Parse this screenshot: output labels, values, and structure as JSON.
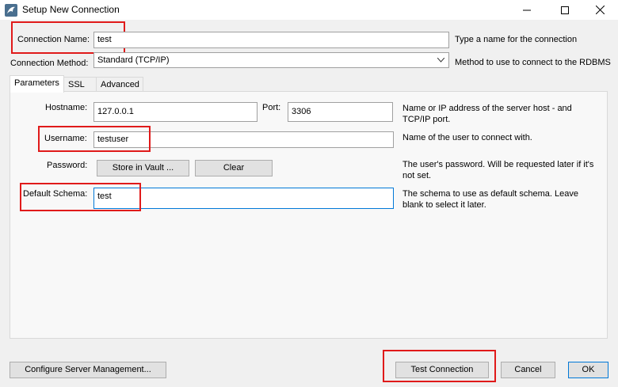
{
  "window": {
    "title": "Setup New Connection",
    "icons": {
      "app": "mysql-dolphin-icon",
      "minimize": "minimize-icon",
      "maximize": "maximize-icon",
      "close": "close-icon"
    }
  },
  "connection": {
    "name_label": "Connection Name:",
    "name_value": "test",
    "name_hint": "Type a name for the connection",
    "method_label": "Connection Method:",
    "method_value": "Standard (TCP/IP)",
    "method_hint": "Method to use to connect to the RDBMS"
  },
  "tabs": [
    {
      "label": "Parameters",
      "active": true
    },
    {
      "label": "SSL",
      "active": false
    },
    {
      "label": "Advanced",
      "active": false
    }
  ],
  "parameters": {
    "hostname_label": "Hostname:",
    "hostname_value": "127.0.0.1",
    "port_label": "Port:",
    "port_value": "3306",
    "hostname_hint": "Name or IP address of the server host - and TCP/IP port.",
    "username_label": "Username:",
    "username_value": "testuser",
    "username_hint": "Name of the user to connect with.",
    "password_label": "Password:",
    "store_vault_label": "Store in Vault ...",
    "clear_label": "Clear",
    "password_hint": "The user's password. Will be requested later if it's not set.",
    "schema_label": "Default Schema:",
    "schema_value": "test",
    "schema_hint": "The schema to use as default schema. Leave blank to select it later."
  },
  "footer": {
    "configure_label": "Configure Server Management...",
    "test_label": "Test Connection",
    "cancel_label": "Cancel",
    "ok_label": "OK"
  },
  "colors": {
    "highlight": "#e01a1a",
    "focus": "#0078d7",
    "background": "#f0f0f0"
  }
}
